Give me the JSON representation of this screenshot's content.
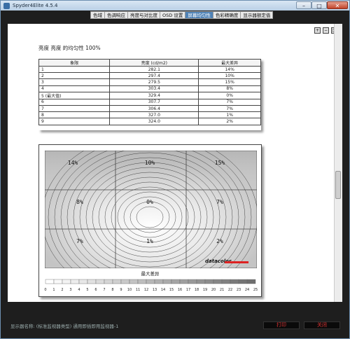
{
  "window": {
    "title": "Spyder4Elite 4.5.4",
    "min": "–",
    "max": "□",
    "close": "✕"
  },
  "tabs": [
    {
      "label": "色域",
      "active": false
    },
    {
      "label": "色调响应",
      "active": false
    },
    {
      "label": "亮度与对比度",
      "active": false
    },
    {
      "label": "OSD 设置",
      "active": false
    },
    {
      "label": "屏幕均匀性",
      "active": true
    },
    {
      "label": "色彩精确度",
      "active": false
    },
    {
      "label": "显示器额定值",
      "active": false
    }
  ],
  "zoom": {
    "in": "+",
    "out": "−",
    "fit": "□"
  },
  "report": {
    "title": "亮度 亮度 的均匀性 100%",
    "table": {
      "headers": [
        "象限",
        "亮度 (cd/m2)",
        "最大差异"
      ],
      "rows": [
        [
          "1",
          "282.1",
          "14%"
        ],
        [
          "2",
          "297.4",
          "10%"
        ],
        [
          "3",
          "279.5",
          "15%"
        ],
        [
          "4",
          "303.4",
          "8%"
        ],
        [
          "5 (最大值)",
          "329.4",
          "0%"
        ],
        [
          "6",
          "307.7",
          "7%"
        ],
        [
          "7",
          "306.4",
          "7%"
        ],
        [
          "8",
          "327.0",
          "1%"
        ],
        [
          "9",
          "324.0",
          "2%"
        ]
      ]
    },
    "heatmap": {
      "cells": [
        "14%",
        "10%",
        "15%",
        "8%",
        "0%",
        "7%",
        "7%",
        "1%",
        "2%"
      ],
      "logo": "datacolor",
      "scale_title": "最大差异",
      "scale_ticks": [
        "0",
        "1",
        "2",
        "3",
        "4",
        "5",
        "6",
        "7",
        "8",
        "9",
        "10",
        "11",
        "12",
        "13",
        "14",
        "15",
        "16",
        "17",
        "18",
        "19",
        "20",
        "21",
        "22",
        "23",
        "24",
        "25"
      ]
    }
  },
  "footer": {
    "device": "显示器名称: (标准监视器类型) 通用即插即用监视器-1",
    "print": "打印",
    "close": "关闭"
  }
}
